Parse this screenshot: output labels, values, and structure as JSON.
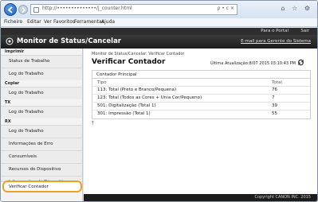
{
  "browser": {
    "url": "http://••••••••••••••/j_counter.html",
    "url_tools": "ρ • c ×",
    "window_icons": "⌂ ☆ ⚙",
    "menu": [
      "Ficheiro",
      "Editar",
      "Ver",
      "Favoritos",
      "Ferramentas",
      "Ajuda"
    ]
  },
  "app": {
    "header_links": [
      "Para o Portal",
      "Sair"
    ],
    "title": "Monitor de Status/Cancelar",
    "mail_link": "E-mail para Gerente do Sistema"
  },
  "sidebar": {
    "groups": [
      {
        "label": "Imprimir",
        "items": [
          "Status de Trabalho",
          "Log do Trabalho"
        ]
      },
      {
        "label": "Copiar",
        "items": [
          "Log do Trabalho"
        ]
      },
      {
        "label": "TX",
        "items": [
          "Log do Trabalho"
        ]
      },
      {
        "label": "RX",
        "items": [
          "Log do Trabalho"
        ]
      }
    ],
    "extra_items": [
      "Informações de Erro",
      "Consumíveis",
      "Recursos do Dispositivo",
      "Informações do Dispositivo",
      "Verificar Contador"
    ]
  },
  "main": {
    "breadcrumb": "Monitor de Status/Cancelar: Verificar Contador",
    "title": "Verificar Contador",
    "last_update": "Última Atualização:8/07 2015 03:10:43 PM",
    "section_title": "Contador Principal",
    "col_type": "Tipo",
    "col_total": "Total",
    "rows": [
      {
        "label": "113: Total (Preto e Branco/Pequena)",
        "value": "76"
      },
      {
        "label": "123: Total (Todos as Cores + Unia Cor/Pequeno)",
        "value": "7"
      },
      {
        "label": "501: Digitalização (Total 1)",
        "value": "39"
      },
      {
        "label": "301: Impressão (Total 1)",
        "value": "55"
      }
    ],
    "top_icon": "⤒"
  },
  "footer": {
    "copyright": "Copyright CANON INC. 2015"
  }
}
